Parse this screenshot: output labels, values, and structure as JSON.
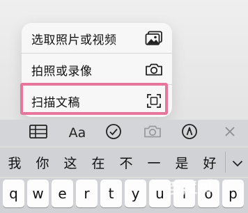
{
  "menu": {
    "items": [
      {
        "label": "选取照片或视频",
        "icon": "photo-library-icon"
      },
      {
        "label": "拍照或录像",
        "icon": "camera-icon"
      },
      {
        "label": "扫描文稿",
        "icon": "document-scan-icon"
      }
    ]
  },
  "toolbar": {
    "format_label": "Aa",
    "buttons": [
      "table-icon",
      "format-icon",
      "checklist-icon",
      "camera-icon",
      "markup-icon",
      "close-icon"
    ]
  },
  "candidates": [
    "我",
    "你",
    "这",
    "在",
    "不",
    "一",
    "是",
    "好"
  ],
  "keys": [
    "q",
    "w",
    "e",
    "r",
    "t",
    "y",
    "u",
    "i",
    "o",
    "p"
  ],
  "watermark": "百度可",
  "colors": {
    "highlight": "#e8769c",
    "keyboard_bg": "#d1d2d6",
    "menu_bg": "#f7f7f7"
  }
}
